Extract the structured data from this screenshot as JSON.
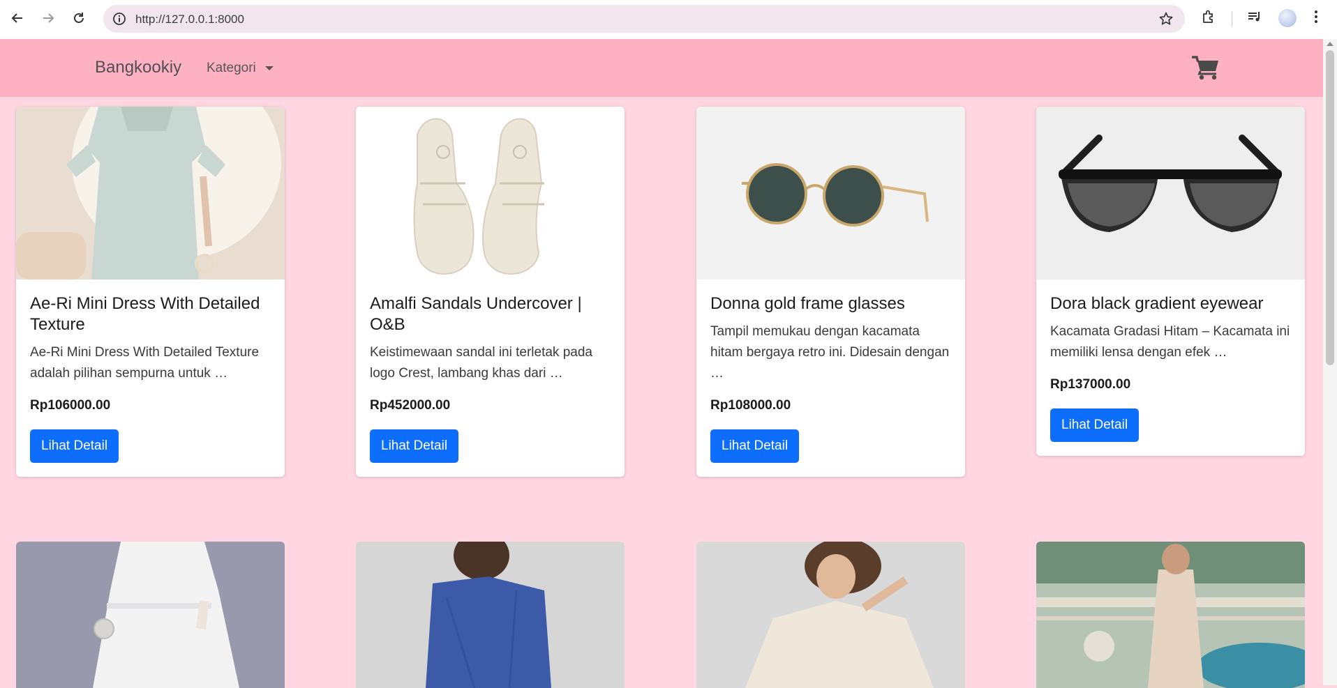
{
  "browser": {
    "url": "http://127.0.0.1:8000",
    "icons": [
      "back-icon",
      "forward-icon",
      "reload-icon",
      "site-info-icon",
      "bookmark-star-icon",
      "extensions-icon",
      "media-controls-icon",
      "profile-avatar",
      "menu-dots-icon"
    ]
  },
  "navbar": {
    "brand": "Bangkookiy",
    "kategori": "Kategori",
    "cart_icon": "shopping-cart-icon"
  },
  "products": [
    {
      "name": "Ae-Ri Mini Dress With Detailed Texture",
      "desc": "Ae-Ri Mini Dress With Detailed Texture adalah pilihan sempurna untuk …",
      "price": "Rp106000.00",
      "button": "Lihat Detail"
    },
    {
      "name": "Amalfi Sandals Undercover | O&B",
      "desc": "Keistimewaan sandal ini terletak pada logo Crest, lambang khas dari …",
      "price": "Rp452000.00",
      "button": "Lihat Detail"
    },
    {
      "name": "Donna gold frame glasses",
      "desc": "Tampil memukau dengan kacamata hitam bergaya retro ini. Didesain dengan …",
      "price": "Rp108000.00",
      "button": "Lihat Detail"
    },
    {
      "name": "Dora black gradient eyewear",
      "desc": "Kacamata Gradasi Hitam – Kacamata ini memiliki lensa dengan efek …",
      "price": "Rp137000.00",
      "button": "Lihat Detail"
    }
  ],
  "colors": {
    "page_bg": "#ffd6e1",
    "navbar_bg": "#ffb1c4",
    "button_bg": "#0d6efd"
  }
}
